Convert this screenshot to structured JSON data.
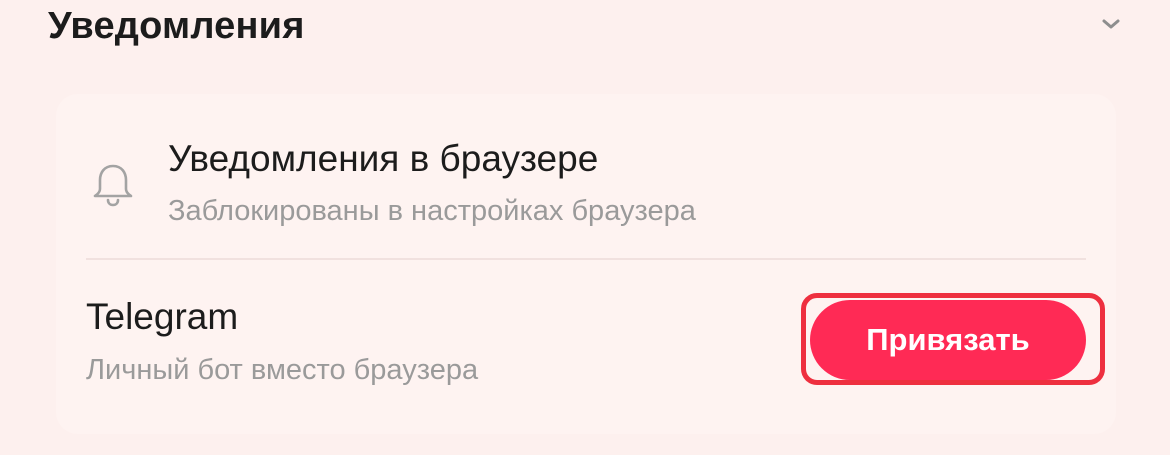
{
  "section": {
    "title": "Уведомления",
    "collapse_icon": "chevron-down-icon"
  },
  "notifications": {
    "browser": {
      "icon": "bell-icon",
      "title": "Уведомления в браузере",
      "subtitle": "Заблокированы в настройках браузера"
    },
    "telegram": {
      "title": "Telegram",
      "subtitle": "Личный бот вместо браузера",
      "button_label": "Привязать"
    }
  },
  "colors": {
    "background": "#fdf0ee",
    "card": "#fef3f1",
    "accent": "#ff2a55",
    "highlight_border": "#ee2f3f",
    "text_primary": "#1c1c1c",
    "text_secondary": "#9a9a9a"
  }
}
